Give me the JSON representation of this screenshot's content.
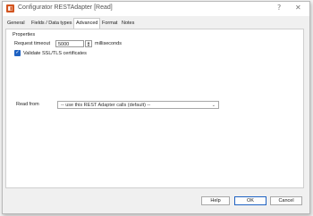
{
  "window": {
    "title": "Configurator RESTAdapter [Read]",
    "app_icon": "app-icon",
    "help_glyph": "?",
    "close_glyph": "✕"
  },
  "tabs": [
    {
      "label": "General",
      "active": false
    },
    {
      "label": "Fields / Data types",
      "active": false
    },
    {
      "label": "Advanced",
      "active": true
    },
    {
      "label": "Format",
      "active": false
    },
    {
      "label": "Notes",
      "active": false
    }
  ],
  "properties": {
    "group_label": "Properties",
    "request_timeout_label": "Request timeout",
    "request_timeout_value": "5000",
    "request_timeout_unit": "milliseconds",
    "validate_ssl_label": "Validate SSL/TLS certificates",
    "validate_ssl_checked": true,
    "read_from_label": "Read from",
    "read_from_value": "-- use this REST Adapter calls (default) --"
  },
  "buttons": {
    "help": "Help",
    "ok": "OK",
    "cancel": "Cancel"
  },
  "colors": {
    "accent": "#1f62c2",
    "app_icon": "#d2541f"
  }
}
